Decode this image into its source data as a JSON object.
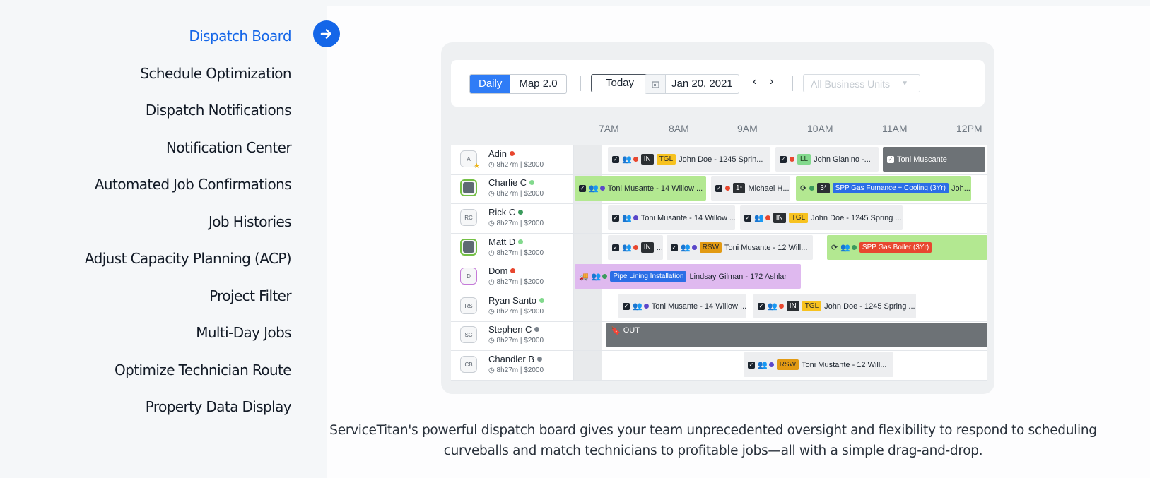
{
  "nav": {
    "items": [
      {
        "label": "Dispatch Board",
        "active": true
      },
      {
        "label": "Schedule Optimization"
      },
      {
        "label": "Dispatch Notifications"
      },
      {
        "label": "Notification Center"
      },
      {
        "label": "Automated Job Confirmations"
      },
      {
        "label": "Job Histories"
      },
      {
        "label": "Adjust Capacity Planning (ACP)"
      },
      {
        "label": "Project Filter"
      },
      {
        "label": "Multi-Day Jobs"
      },
      {
        "label": "Optimize Technician Route"
      },
      {
        "label": "Property Data Display"
      }
    ],
    "arrow_icon": "arrow-right-icon",
    "accent": "#1466e8"
  },
  "board": {
    "view_daily": "Daily",
    "view_map": "Map 2.0",
    "today": "Today",
    "date": "Jan 20, 2021",
    "prev": "‹",
    "next": "›",
    "business_units_placeholder": "All Business Units",
    "hours": [
      "7AM",
      "8AM",
      "9AM",
      "10AM",
      "11AM",
      "12PM"
    ],
    "technicians": [
      {
        "initials": "A",
        "name": "Adin",
        "status": "#e8472f",
        "hours": "8h27m",
        "amount": "$2000"
      },
      {
        "initials": "",
        "name": "Charlie C",
        "status": "#82d98d",
        "hours": "8h27m",
        "amount": "$2000"
      },
      {
        "initials": "RC",
        "name": "Rick C",
        "status": "#3a9b5c",
        "hours": "8h27m",
        "amount": "$2000"
      },
      {
        "initials": "",
        "name": "Matt D",
        "status": "#82d98d",
        "hours": "8h27m",
        "amount": "$2000"
      },
      {
        "initials": "D",
        "name": "Dom",
        "status": "#e8472f",
        "hours": "8h27m",
        "amount": "$2000"
      },
      {
        "initials": "RS",
        "name": "Ryan Santo",
        "status": "#82d98d",
        "hours": "8h27m",
        "amount": "$2000"
      },
      {
        "initials": "SC",
        "name": "Stephen C",
        "status": "#7d858e",
        "hours": "8h27m",
        "amount": "$2000"
      },
      {
        "initials": "CB",
        "name": "Chandler B",
        "status": "#7d858e",
        "hours": "8h27m",
        "amount": "$2000"
      }
    ],
    "jobs": {
      "r0a": {
        "tag1": "IN",
        "tag2": "TGL",
        "text": "John Doe - 1245 Sprin..."
      },
      "r0b": {
        "tag": "LL",
        "text": "John Gianino -..."
      },
      "r0c": {
        "text": "Toni Muscante"
      },
      "r1a": {
        "text": "Toni Musante - 14 Willow ..."
      },
      "r1b": {
        "tag": "1*",
        "text": "Michael H..."
      },
      "r1c": {
        "tag1": "3*",
        "tag2": "SPP Gas Furnance + Cooling (3Yr)",
        "text": "Joh..."
      },
      "r2a": {
        "text": "Toni Musante - 14 Willow ..."
      },
      "r2b": {
        "tag1": "IN",
        "tag2": "TGL",
        "text": "John Doe - 1245 Spring ..."
      },
      "r3a": {
        "tag": "IN",
        "text": "..."
      },
      "r3b": {
        "tag": "RSW",
        "text": "Toni Musante - 12 Will..."
      },
      "r3c": {
        "tag": "SPP Gas Boiler (3Yr)"
      },
      "r4a": {
        "tag": "Pipe Lining Installation",
        "text": "Lindsay Gilman - 172 Ashlar"
      },
      "r5a": {
        "text": "Toni Musante - 14 Willow ..."
      },
      "r5b": {
        "tag1": "IN",
        "tag2": "TGL",
        "text": "John Doe - 1245 Spring ..."
      },
      "r6a": {
        "text": "OUT"
      },
      "r7a": {
        "tag": "RSW",
        "text": "Toni Mustante - 12 Will..."
      }
    }
  },
  "caption": "ServiceTitan's powerful dispatch board gives your team unprecedented oversight and flexibility to respond to scheduling curveballs and match technicians to profitable jobs—all with a simple drag-and-drop."
}
